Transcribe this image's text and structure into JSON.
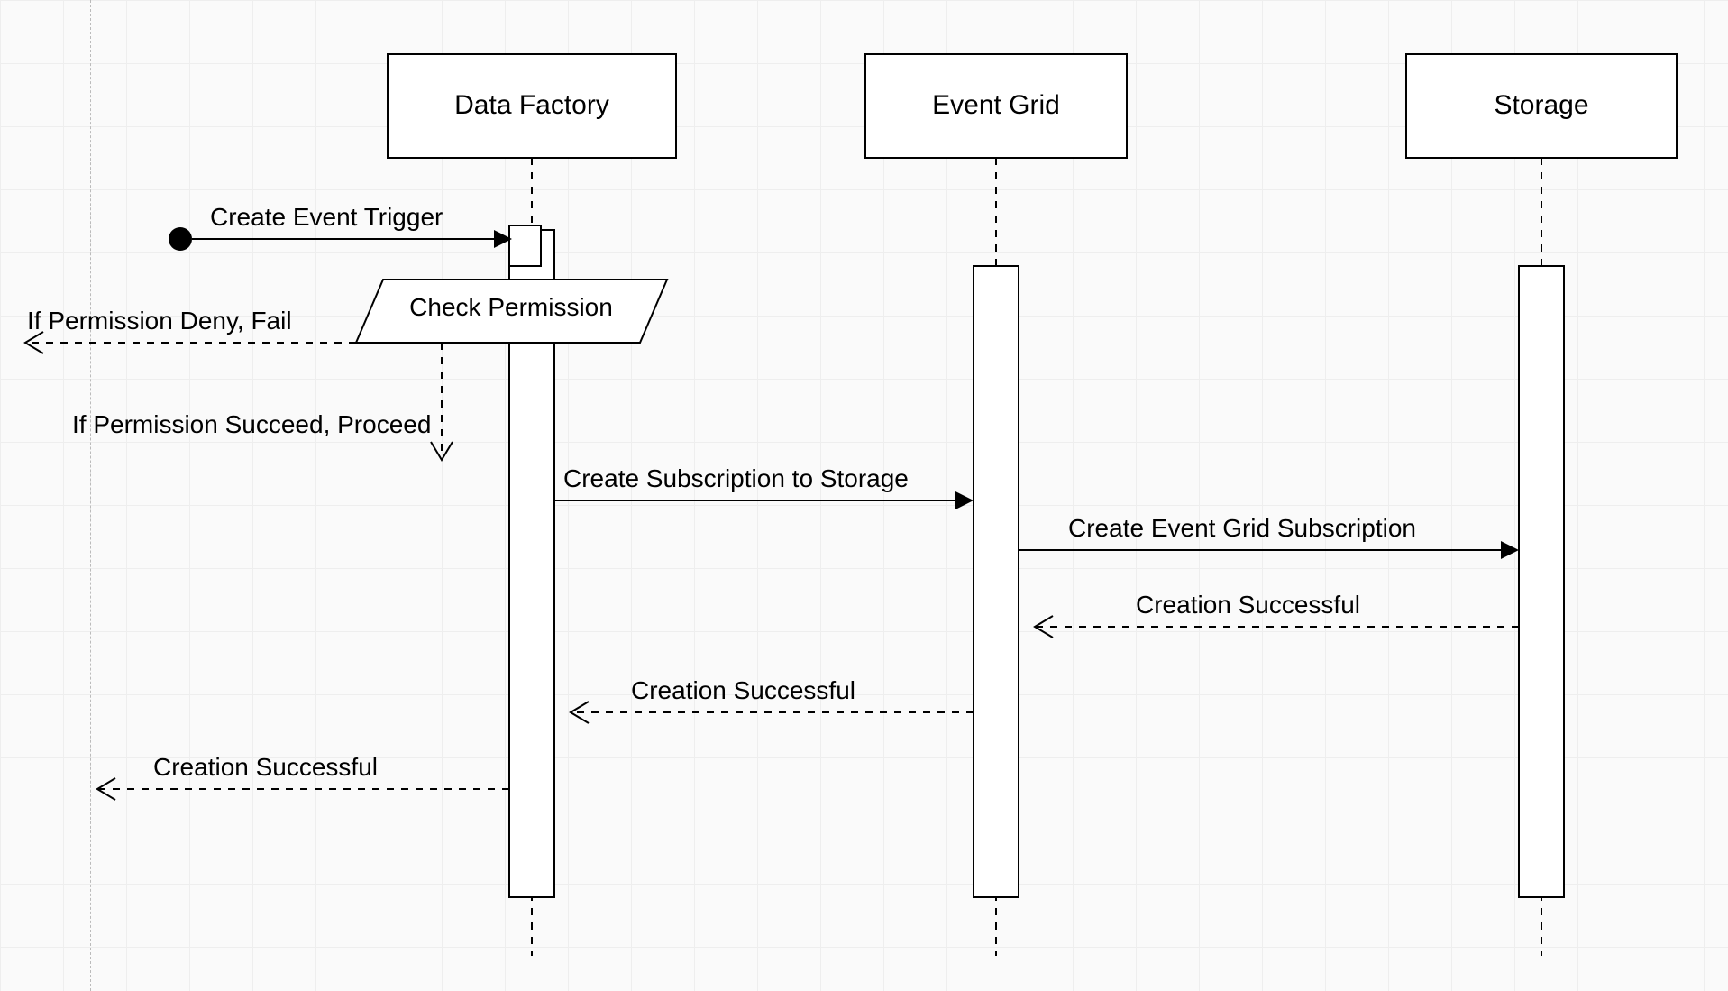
{
  "participants": {
    "data_factory": "Data Factory",
    "event_grid": "Event Grid",
    "storage": "Storage"
  },
  "labels": {
    "create_event_trigger": "Create Event Trigger",
    "check_permission": "Check Permission",
    "if_permission_deny": "If Permission Deny, Fail",
    "if_permission_succeed": "If Permission Succeed, Proceed",
    "create_subscription": "Create Subscription to Storage",
    "create_event_grid_sub": "Create Event Grid Subscription",
    "creation_successful_sg": "Creation Successful",
    "creation_successful_eg": "Creation Successful",
    "creation_successful_df": "Creation Successful"
  }
}
